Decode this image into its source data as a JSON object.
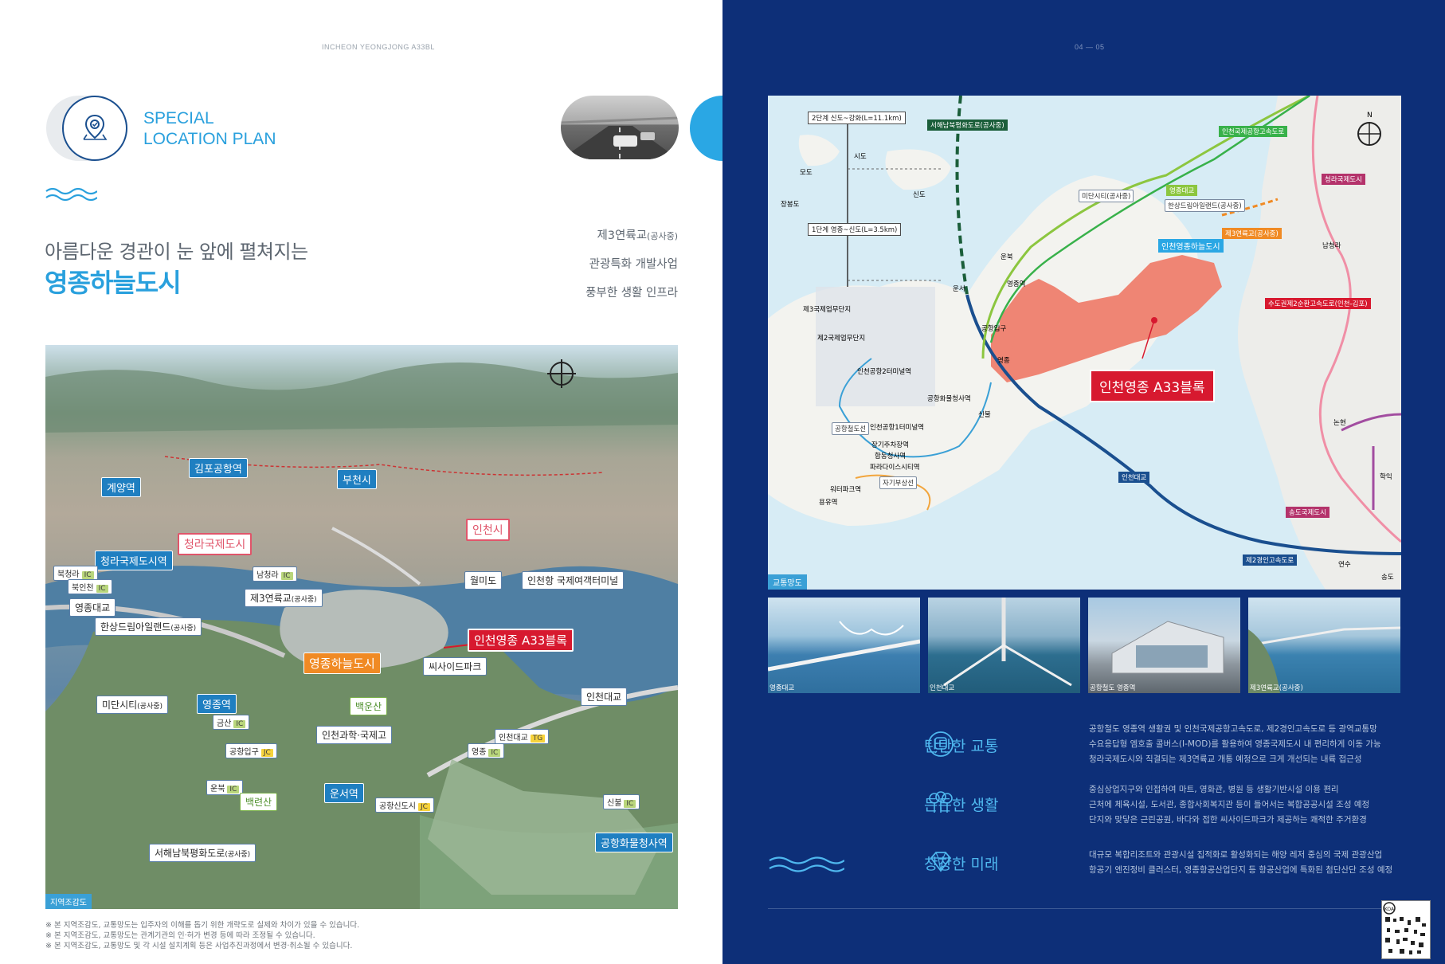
{
  "left_page": {
    "header": "INCHEON YEONGJONG A33BL",
    "special_line1": "SPECIAL",
    "special_line2": "LOCATION PLAN",
    "headline": "아름다운 경관이 눈 앞에 펼쳐지는",
    "headline_strong": "영종하늘도시",
    "features": [
      {
        "main": "제3연륙교",
        "sub": "(공사중)"
      },
      {
        "main": "관광특화 개발사업",
        "sub": ""
      },
      {
        "main": "풍부한 생활 인프라",
        "sub": ""
      }
    ],
    "aerial": {
      "corner_label": "지역조감도",
      "labels": {
        "gimpo_airport": "김포공항역",
        "gyeyang": "계양역",
        "bucheon": "부천시",
        "incheon_city": "인천시",
        "cheongna_city": "청라국제도시",
        "cheongna_station": "청라국제도시역",
        "bukcheongna": "북청라",
        "bukincheon": "북인천",
        "namcheongna": "남청라",
        "wolmido": "월미도",
        "cruise_terminal": "인천항 국제여객터미널",
        "yeongjong_bridge": "영종대교",
        "bridge3": "제3연륙교",
        "bridge3_sub": "(공사중)",
        "hansang": "한상드림아일랜드",
        "hansang_sub": "(공사중)",
        "yeongjong_sky": "영종하늘도시",
        "a33": "인천영종 A33블록",
        "seaside_park": "씨사이드파크",
        "incheon_bridge": "인천대교",
        "midan": "미단시티",
        "midan_sub": "(공사중)",
        "yeongjong_station": "영종역",
        "geumsan": "금산",
        "baekunsan": "백운산",
        "science_high": "인천과학·국제고",
        "incheon_bridge_tg": "인천대교",
        "airport_entrance": "공항입구",
        "yeongjong_ic": "영종",
        "unbuk": "운북",
        "unseo_station": "운서역",
        "baekryeonsan": "백련산",
        "airport_new_city": "공항신도시",
        "sinbul": "신불",
        "seohae_road": "서해남북평화도로",
        "seohae_sub": "(공사중)",
        "cargo_station": "공항화물청사역"
      },
      "marks": {
        "ic": "IC",
        "jc": "JC",
        "tg": "TG"
      }
    },
    "notes": [
      "※ 본 지역조감도, 교통망도는 입주자의 이해를 돕기 위한 개략도로 실제와 차이가 있을 수 있습니다.",
      "※ 본 지역조감도, 교통망도는 관계기관의 인·허가 변경 등에 따라 조정될 수 있습니다.",
      "※ 본 지역조감도, 교통망도 및 각 시설 설치계획 등은 사업추진과정에서 변경·취소될 수 있습니다."
    ]
  },
  "right_page": {
    "header": "04 — 05",
    "map": {
      "corner_label": "교통망도",
      "phase2": "2단계 신도~강화(L=11.1km)",
      "phase1": "1단계 영종~신도(L=3.5km)",
      "seohae": "서해남북평화도로(공사중)",
      "expressway1": "인천국제공항고속도로",
      "yeongjong_bridge": "영종대교",
      "hansang": "한상드림아일랜드(공사중)",
      "midan": "미단시티(공사중)",
      "cheongna": "청라국제도시",
      "bridge3": "제3연륙교(공사중)",
      "sky_city": "인천영종하늘도시",
      "sudokwon": "수도권제2순환고속도로(인천-김포)",
      "a33": "인천영종 A33블록",
      "incheon_bridge": "인천대교",
      "songdo": "송도국제도시",
      "expressway2": "제2경인고속도로",
      "airport_rail": "공항철도선",
      "terminal1": "인천공항1터미널역",
      "terminal2": "인천공항2터미널역",
      "cargo": "공항화물청사역",
      "longterm": "장기주차장역",
      "hapdong": "합동청사역",
      "paradise": "파라다이스시티역",
      "waterpark": "워터파크역",
      "jagi": "자기부상선",
      "yongyu": "용유역",
      "sinbul": "신불",
      "yeongjong": "영종",
      "airport_entrance": "공항입구",
      "unbuk": "운북",
      "unseo": "운서",
      "namcheongna": "남청라",
      "nonhyeon": "논현",
      "hakik": "학익",
      "yeonsu": "연수",
      "songdo_ic": "송도",
      "industrial3": "제3국제업무단지",
      "industrial2": "제2국제업무단지",
      "yeongjong_station": "영종역",
      "sido": "시도",
      "modo": "모도",
      "sindo": "신도",
      "jangbongdo": "장봉도",
      "north": "N"
    },
    "photos": [
      {
        "caption": "영종대교"
      },
      {
        "caption": "인천대교"
      },
      {
        "caption": "공항철도 영종역"
      },
      {
        "caption": "제3연륙교(공사중)"
      }
    ],
    "benefits": [
      {
        "icon": "train-icon",
        "title": "탄탄한 교통",
        "lines": [
          "공항철도 영종역 생활권 및 인천국제공항고속도로, 제2경인고속도로 등 광역교통망",
          "수요응답형 엠호출 콜버스(I-MOD)를 활용하여 영종국제도시 내 편리하게 이동 가능",
          "청라국제도시와 직결되는 제3연륙교 개통 예정으로 크게 개선되는 내륙 접근성"
        ]
      },
      {
        "icon": "trees-icon",
        "title": "든든한 생활",
        "lines": [
          "중심상업지구와 인접하여 마트, 영화관, 병원 등 생활기반시설 이용 편리",
          "근처에 체육시설, 도서관, 종합사회복지관 등이 들어서는 복합공공시설 조성 예정",
          "단지와 맞닿은 근린공원, 바다와 접한 씨사이드파크가 제공하는 쾌적한 주거환경"
        ]
      },
      {
        "icon": "diamond-icon",
        "title": "창창한 미래",
        "lines": [
          "대규모 복합리조트와 관광시설 집적화로 활성화되는 해양 레저 중심의 국제 관광산업",
          "항공기 엔진정비 클러스터, 영종항공산업단지 등 항공산업에 특화된 첨단산단 조성 예정"
        ]
      }
    ],
    "qr_label": "KOA"
  },
  "colors": {
    "accent_blue": "#29a0dd",
    "navy": "#0d2f78",
    "red": "#d7192f",
    "salmon": "#ef8574"
  }
}
